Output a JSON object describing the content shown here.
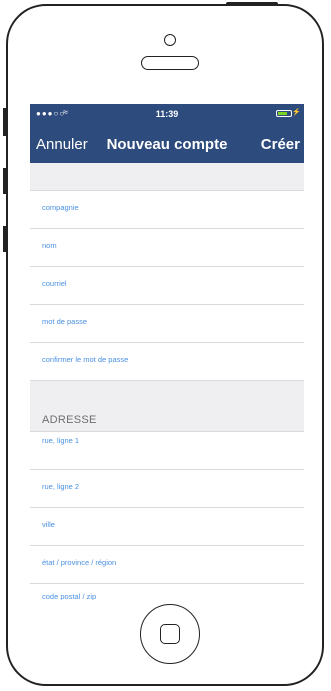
{
  "statusbar": {
    "signal": "●●●○○",
    "wifi": "≈",
    "time": "11:39",
    "charge": "⚡"
  },
  "navbar": {
    "cancel_label": "Annuler",
    "title": "Nouveau compte",
    "create_label": "Créer"
  },
  "form": {
    "fields": [
      {
        "placeholder": "compagnie"
      },
      {
        "placeholder": "nom"
      },
      {
        "placeholder": "courriel"
      },
      {
        "placeholder": "mot de passe"
      },
      {
        "placeholder": "confirmer le mot de passe"
      }
    ],
    "address_section_title": "ADRESSE",
    "address_fields": [
      {
        "placeholder": "rue, ligne 1"
      },
      {
        "placeholder": "rue, ligne 2"
      },
      {
        "placeholder": "ville"
      },
      {
        "placeholder": "état / province / région"
      },
      {
        "placeholder": "code postal / zip"
      }
    ]
  },
  "colors": {
    "bar": "#2d4b7d",
    "placeholder": "#4a90e2",
    "battery": "#7ed321"
  }
}
